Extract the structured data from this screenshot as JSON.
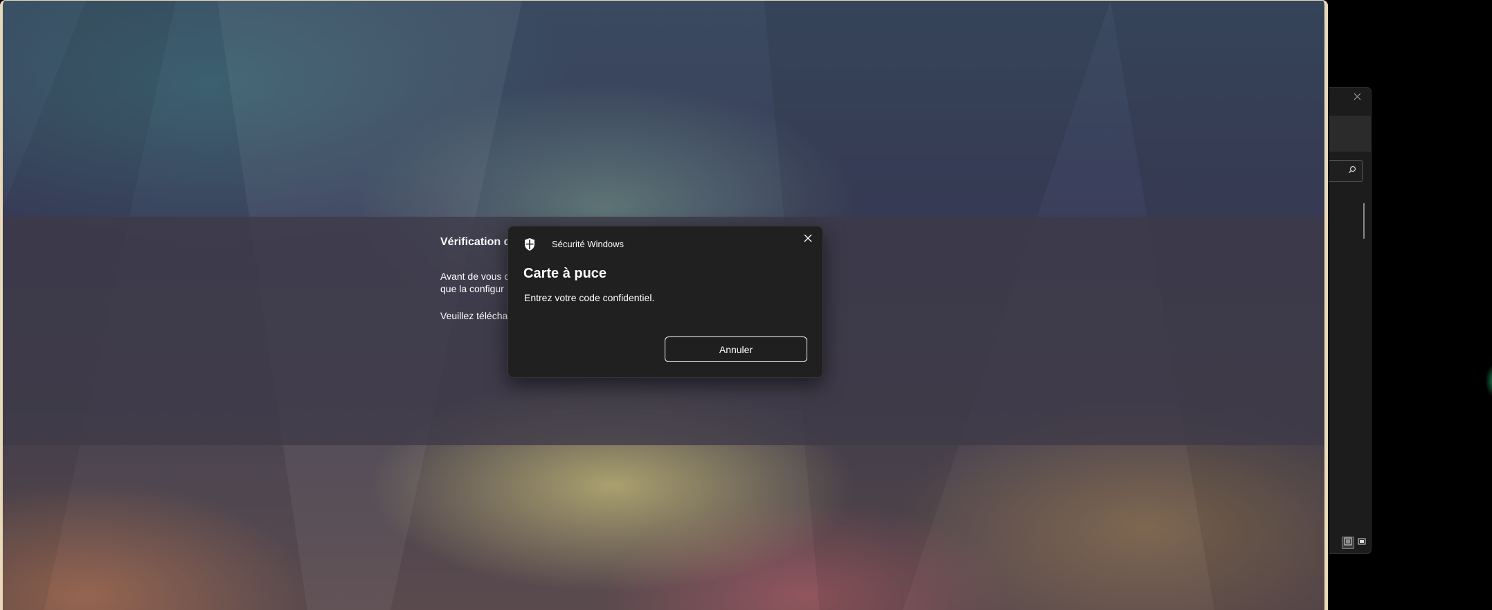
{
  "background_window": {
    "title": "Vérification d",
    "lines": [
      "Avant de vous c",
      "que la configur",
      "Veuillez téléchar"
    ]
  },
  "dialog": {
    "app_name": "Sécurité Windows",
    "title": "Carte à puce",
    "message": "Entrez votre code confidentiel.",
    "cancel_label": "Annuler",
    "icons": {
      "app": "shield-icon",
      "close": "close-icon"
    }
  },
  "side_window": {
    "icons": [
      "close-icon",
      "search-icon",
      "details-view-icon",
      "large-icons-view-icon"
    ]
  },
  "colors": {
    "dialog_bg": "#202020",
    "window_border": "#e8d9b8",
    "text": "#ffffff"
  }
}
